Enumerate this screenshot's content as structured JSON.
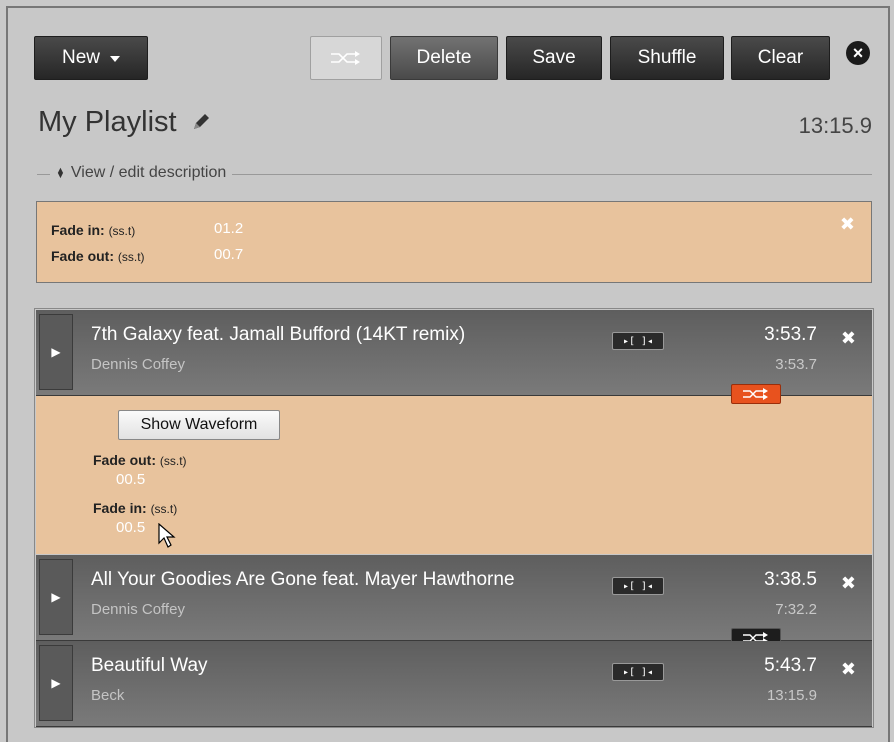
{
  "toolbar": {
    "new_label": "New",
    "delete_label": "Delete",
    "save_label": "Save",
    "shuffle_label": "Shuffle",
    "clear_label": "Clear",
    "close_icon": "×"
  },
  "playlist": {
    "title": "My Playlist",
    "total_duration": "13:15.9",
    "description_toggle": "View / edit description"
  },
  "fade_settings": {
    "fade_in_label": "Fade in:",
    "fade_in_unit": "(ss.t)",
    "fade_in_value": "01.2",
    "fade_out_label": "Fade out:",
    "fade_out_unit": "(ss.t)",
    "fade_out_value": "00.7",
    "close": "✖"
  },
  "tracks": [
    {
      "title": "7th Galaxy feat. Jamall Bufford (14KT remix)",
      "artist": "Dennis Coffey",
      "duration": "3:53.7",
      "cumulative": "3:53.7",
      "remove": "✖",
      "trim_icon": "▸[ ]◂",
      "play_icon": "▶"
    },
    {
      "title": "All Your Goodies Are Gone feat. Mayer Hawthorne",
      "artist": "Dennis Coffey",
      "duration": "3:38.5",
      "cumulative": "7:32.2",
      "remove": "✖",
      "trim_icon": "▸[ ]◂",
      "play_icon": "▶"
    },
    {
      "title": "Beautiful Way",
      "artist": "Beck",
      "duration": "5:43.7",
      "cumulative": "13:15.9",
      "remove": "✖",
      "trim_icon": "▸[ ]◂",
      "play_icon": "▶"
    }
  ],
  "track_edit": {
    "waveform_button": "Show Waveform",
    "fade_out_label": "Fade out:",
    "fade_out_unit": "(ss.t)",
    "fade_out_value": "00.5",
    "fade_in_label": "Fade in:",
    "fade_in_unit": "(ss.t)",
    "fade_in_value": "00.5"
  },
  "colors": {
    "panel_peach": "#e8c39d",
    "shuffle_active": "#e8521e",
    "track_bg": "#6a6a6a"
  },
  "icons": {
    "shuffle": "shuffle-icon",
    "pencil": "pencil-icon",
    "trim": "trim-icon",
    "play": "play-icon",
    "close": "close-icon"
  }
}
